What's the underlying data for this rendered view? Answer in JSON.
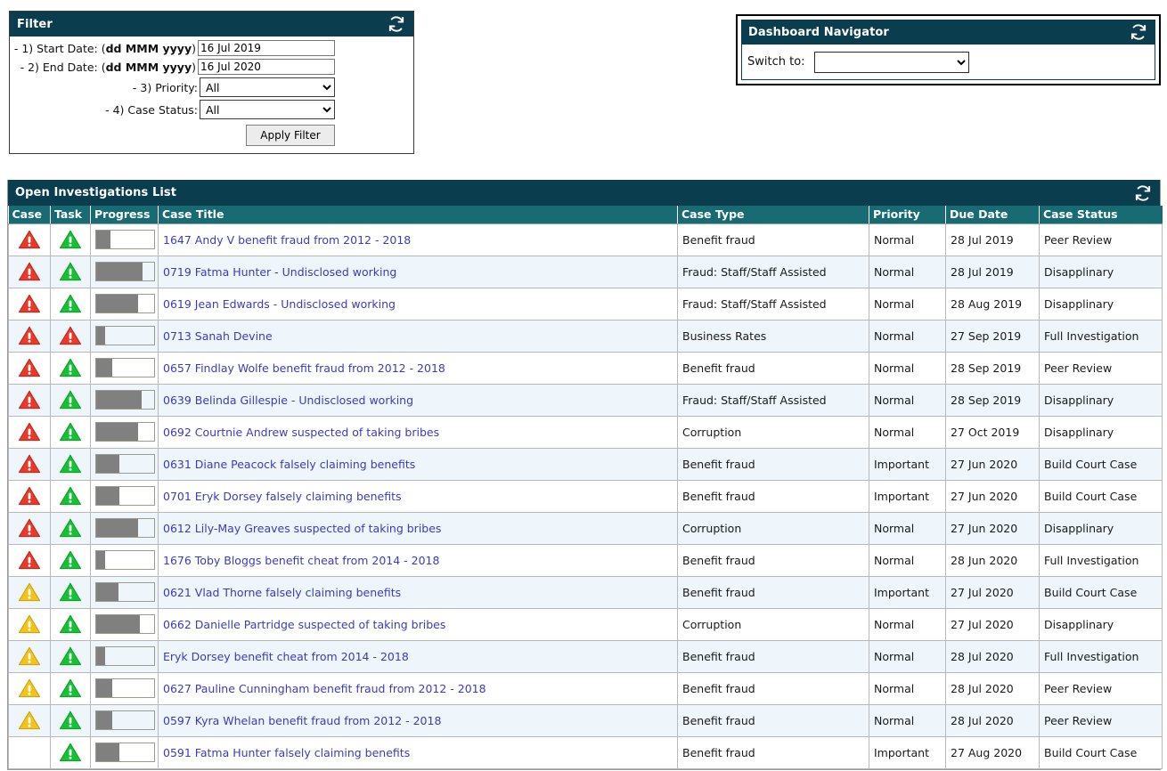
{
  "filter": {
    "title": "Filter",
    "refresh_icon": "refresh-icon",
    "rows": [
      {
        "label_plain": "- 1) Start Date: (",
        "label_bold": "dd MMM yyyy",
        "label_tail": ")",
        "value": "16 Jul 2019",
        "placeholder": "dd MMM yyyy"
      },
      {
        "label_plain": "- 2) End Date: (",
        "label_bold": "dd MMM yyyy",
        "label_tail": ")",
        "value": "16 Jul 2020",
        "placeholder": "dd MMM yyyy"
      }
    ],
    "priority_label": "- 3) Priority:",
    "priority_value": "All",
    "status_label": "- 4) Case Status:",
    "status_value": "All",
    "apply_label": "Apply Filter"
  },
  "navigator": {
    "title": "Dashboard Navigator",
    "refresh_icon": "refresh-icon",
    "switch_label": "Switch to:",
    "switch_value": ""
  },
  "list": {
    "title": "Open Investigations List",
    "refresh_icon": "refresh-icon",
    "columns": [
      "Case",
      "Task",
      "Progress",
      "Case Title",
      "Case Type",
      "Priority",
      "Due Date",
      "Case Status"
    ],
    "rows": [
      {
        "case_icon": "red",
        "task_icon": "green",
        "progress": 25,
        "title": "1647 Andy V benefit fraud from 2012 - 2018",
        "type": "Benefit fraud",
        "priority": "Normal",
        "due": "28 Jul 2019",
        "status": "Peer Review"
      },
      {
        "case_icon": "red",
        "task_icon": "green",
        "progress": 80,
        "title": "0719 Fatma Hunter - Undisclosed working",
        "type": "Fraud: Staff/Staff Assisted",
        "priority": "Normal",
        "due": "28 Jul 2019",
        "status": "Disapplinary"
      },
      {
        "case_icon": "red",
        "task_icon": "green",
        "progress": 72,
        "title": "0619 Jean Edwards - Undisclosed working",
        "type": "Fraud: Staff/Staff Assisted",
        "priority": "Normal",
        "due": "28 Aug 2019",
        "status": "Disapplinary"
      },
      {
        "case_icon": "red",
        "task_icon": "red",
        "progress": 15,
        "title": "0713 Sanah Devine",
        "type": "Business Rates",
        "priority": "Normal",
        "due": "27 Sep 2019",
        "status": "Full Investigation"
      },
      {
        "case_icon": "red",
        "task_icon": "green",
        "progress": 28,
        "title": "0657 Findlay Wolfe benefit fraud from 2012 - 2018",
        "type": "Benefit fraud",
        "priority": "Normal",
        "due": "28 Sep 2019",
        "status": "Peer Review"
      },
      {
        "case_icon": "red",
        "task_icon": "green",
        "progress": 78,
        "title": "0639 Belinda Gillespie - Undisclosed working",
        "type": "Fraud: Staff/Staff Assisted",
        "priority": "Normal",
        "due": "28 Sep 2019",
        "status": "Disapplinary"
      },
      {
        "case_icon": "red",
        "task_icon": "green",
        "progress": 72,
        "title": "0692 Courtnie Andrew suspected of taking bribes",
        "type": "Corruption",
        "priority": "Normal",
        "due": "27 Oct 2019",
        "status": "Disapplinary"
      },
      {
        "case_icon": "red",
        "task_icon": "green",
        "progress": 40,
        "title": "0631 Diane Peacock falsely claiming benefits",
        "type": "Benefit fraud",
        "priority": "Important",
        "due": "27 Jun 2020",
        "status": "Build Court Case"
      },
      {
        "case_icon": "red",
        "task_icon": "green",
        "progress": 40,
        "title": "0701 Eryk Dorsey falsely claiming benefits",
        "type": "Benefit fraud",
        "priority": "Important",
        "due": "27 Jun 2020",
        "status": "Build Court Case"
      },
      {
        "case_icon": "red",
        "task_icon": "green",
        "progress": 72,
        "title": "0612 Lily-May Greaves suspected of taking bribes",
        "type": "Corruption",
        "priority": "Normal",
        "due": "27 Jun 2020",
        "status": "Disapplinary"
      },
      {
        "case_icon": "red",
        "task_icon": "green",
        "progress": 15,
        "title": "1676 Toby Bloggs benefit cheat from 2014 - 2018",
        "type": "Benefit fraud",
        "priority": "Normal",
        "due": "28 Jun 2020",
        "status": "Full Investigation"
      },
      {
        "case_icon": "amber",
        "task_icon": "green",
        "progress": 38,
        "title": "0621 Vlad Thorne falsely claiming benefits",
        "type": "Benefit fraud",
        "priority": "Important",
        "due": "27 Jul 2020",
        "status": "Build Court Case"
      },
      {
        "case_icon": "amber",
        "task_icon": "green",
        "progress": 75,
        "title": "0662 Danielle Partridge suspected of taking bribes",
        "type": "Corruption",
        "priority": "Normal",
        "due": "27 Jul 2020",
        "status": "Disapplinary"
      },
      {
        "case_icon": "amber",
        "task_icon": "green",
        "progress": 15,
        "title": "Eryk Dorsey benefit cheat from 2014 - 2018",
        "type": "Benefit fraud",
        "priority": "Normal",
        "due": "28 Jul 2020",
        "status": "Full Investigation"
      },
      {
        "case_icon": "amber",
        "task_icon": "green",
        "progress": 28,
        "title": "0627 Pauline Cunningham benefit fraud from 2012 - 2018",
        "type": "Benefit fraud",
        "priority": "Normal",
        "due": "28 Jul 2020",
        "status": "Peer Review"
      },
      {
        "case_icon": "amber",
        "task_icon": "green",
        "progress": 28,
        "title": "0597 Kyra Whelan benefit fraud from 2012 - 2018",
        "type": "Benefit fraud",
        "priority": "Normal",
        "due": "28 Jul 2020",
        "status": "Peer Review"
      },
      {
        "case_icon": "none",
        "task_icon": "green",
        "progress": 40,
        "title": "0591 Fatma Hunter falsely claiming benefits",
        "type": "Benefit fraud",
        "priority": "Important",
        "due": "27 Aug 2020",
        "status": "Build Court Case"
      }
    ]
  },
  "colors": {
    "title_bar": "#0a3d4d",
    "column_header": "#186b73",
    "alt_row": "#eef5fb",
    "link": "#3b3bbf",
    "progress_fill": "#808080",
    "icon_red": "#e8392a",
    "icon_green": "#15c236",
    "icon_amber": "#f2c319"
  }
}
